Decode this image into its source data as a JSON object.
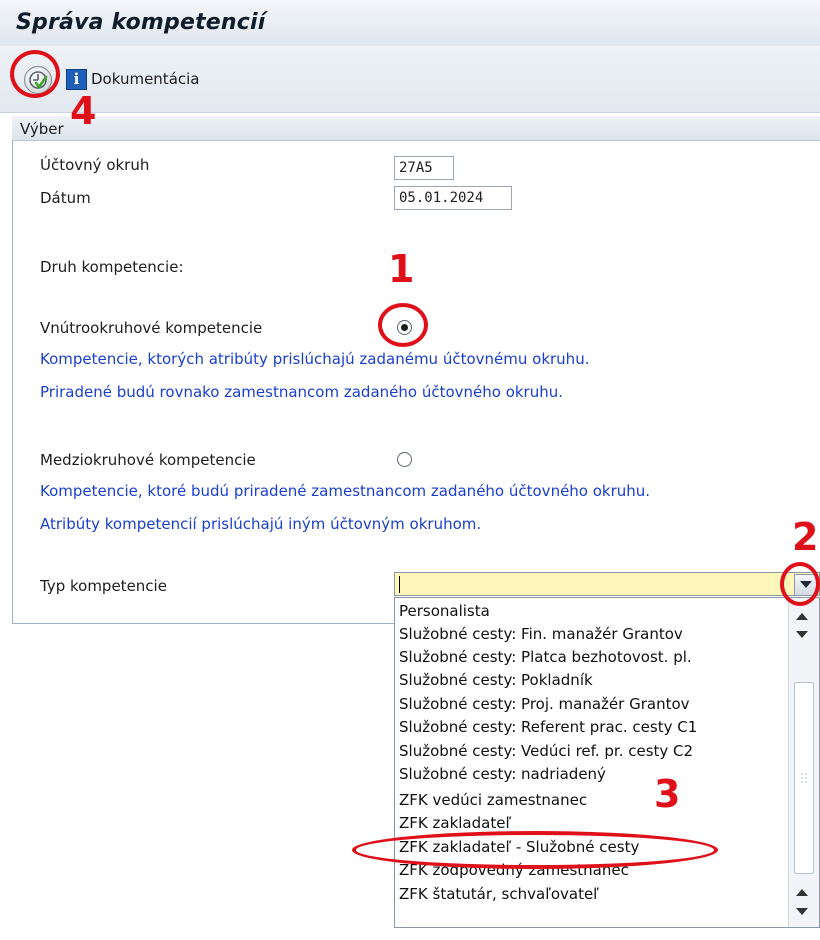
{
  "window": {
    "title": "Správa kompetencií"
  },
  "toolbar": {
    "execute_icon": "execute-clock-check-icon",
    "documentation_label": "Dokumentácia",
    "documentation_icon": "info-icon"
  },
  "selection": {
    "group_title": "Výber",
    "company_code_label": "Účtovný okruh",
    "company_code_value": "27A5",
    "date_label": "Dátum",
    "date_value": "05.01.2024",
    "authority_type_heading": "Druh kompetencie:",
    "intra": {
      "label": "Vnútrookruhové kompetencie",
      "selected": true,
      "hint_line1": "Kompetencie, ktorých atribúty prislúchajú zadanému účtovnému okruhu.",
      "hint_line2": "Priradené budú rovnako zamestnancom zadaného účtovného okruhu."
    },
    "inter": {
      "label": "Medziokruhové kompetencie",
      "selected": false,
      "hint_line1": "Kompetencie, ktoré budú priradené zamestnancom zadaného účtovného okruhu.",
      "hint_line2": "Atribúty kompetencií prislúchajú iným účtovným okruhom."
    },
    "competence_type_label": "Typ kompetencie",
    "competence_type_value": "",
    "dropdown_options": [
      "Personalista",
      "Služobné cesty: Fin. manažér Grantov",
      "Služobné cesty: Platca bezhotovost. pl.",
      "Služobné cesty: Pokladník",
      "Služobné cesty: Proj. manažér Grantov",
      "Služobné cesty: Referent prac. cesty C1",
      "Služobné cesty: Vedúci ref. pr. cesty C2",
      "Služobné cesty: nadriadený",
      "ZFK vedúci zamestnanec",
      "ZFK zakladateľ",
      "ZFK zakladateľ - Služobné cesty",
      "ZFK zodpovedný zamestnanec",
      "ZFK štatutár, schvaľovateľ"
    ]
  },
  "annotations": {
    "color": "#e0101a",
    "markers": [
      "1",
      "2",
      "3",
      "4"
    ]
  },
  "colors": {
    "hint_text": "#1a3fd0",
    "combo_background": "#fff7b9",
    "info_icon": "#1d5fb8"
  }
}
